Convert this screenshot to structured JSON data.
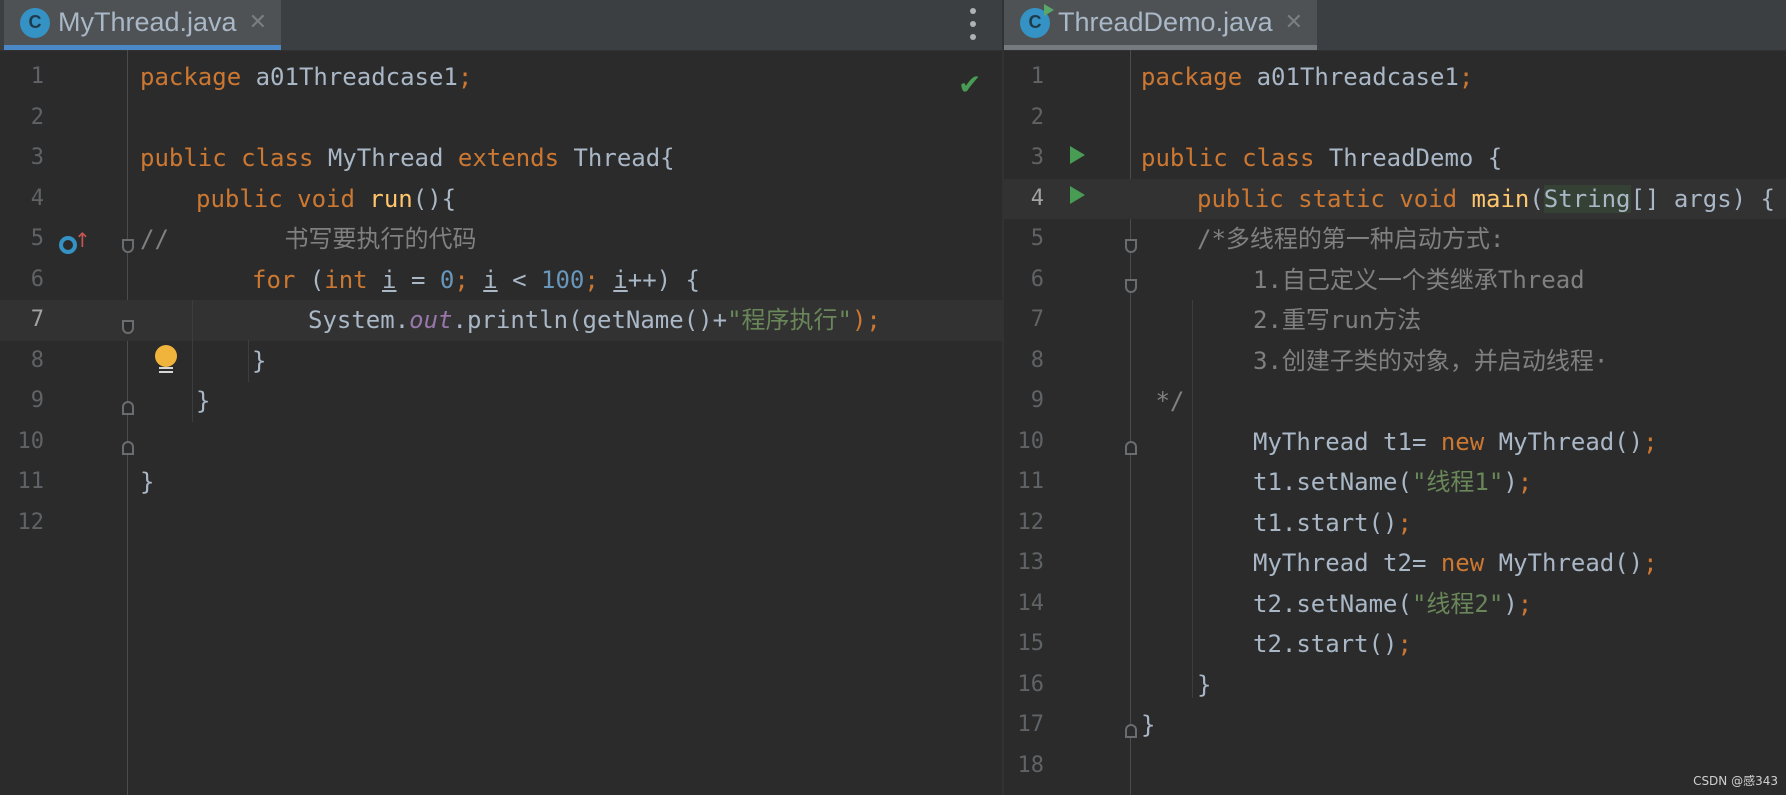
{
  "left_pane": {
    "tab": {
      "icon_letter": "C",
      "title": "MyThread.java",
      "close": "✕"
    },
    "lines": [
      {
        "n": "1",
        "indent": 0,
        "tokens": [
          {
            "t": "package ",
            "c": "kw"
          },
          {
            "t": "a01Threadcase1",
            "c": "sym"
          },
          {
            "t": ";",
            "c": "kw"
          }
        ]
      },
      {
        "n": "2",
        "indent": 0,
        "tokens": []
      },
      {
        "n": "3",
        "indent": 0,
        "tokens": [
          {
            "t": "public class ",
            "c": "kw"
          },
          {
            "t": "MyThread ",
            "c": "sym"
          },
          {
            "t": "extends ",
            "c": "kw"
          },
          {
            "t": "Thread{",
            "c": "sym"
          }
        ]
      },
      {
        "n": "4",
        "indent": 1,
        "tokens": [
          {
            "t": "public void ",
            "c": "kw"
          },
          {
            "t": "run",
            "c": "fn"
          },
          {
            "t": "(){",
            "c": "sym"
          }
        ]
      },
      {
        "n": "5",
        "indent": 0,
        "tokens": [
          {
            "t": "//        书写要执行的代码",
            "c": "cmt"
          }
        ]
      },
      {
        "n": "6",
        "indent": 2,
        "tokens": [
          {
            "t": "for ",
            "c": "kw"
          },
          {
            "t": "(",
            "c": "sym"
          },
          {
            "t": "int ",
            "c": "kw"
          },
          {
            "t": "i",
            "c": "sym und"
          },
          {
            "t": " = ",
            "c": "sym"
          },
          {
            "t": "0",
            "c": "num"
          },
          {
            "t": "; ",
            "c": "kw"
          },
          {
            "t": "i",
            "c": "sym und"
          },
          {
            "t": " < ",
            "c": "sym"
          },
          {
            "t": "100",
            "c": "num"
          },
          {
            "t": "; ",
            "c": "kw"
          },
          {
            "t": "i",
            "c": "sym und"
          },
          {
            "t": "++) {",
            "c": "sym"
          }
        ]
      },
      {
        "n": "7",
        "indent": 3,
        "tokens": [
          {
            "t": "System.",
            "c": "sym"
          },
          {
            "t": "out",
            "c": "fld"
          },
          {
            "t": ".println(getName()+",
            "c": "sym"
          },
          {
            "t": "\"程序执行\"",
            "c": "str"
          },
          {
            "t": ");",
            "c": "kw"
          }
        ]
      },
      {
        "n": "8",
        "indent": 2,
        "tokens": [
          {
            "t": "}",
            "c": "sym"
          }
        ]
      },
      {
        "n": "9",
        "indent": 1,
        "tokens": [
          {
            "t": "}",
            "c": "sym"
          }
        ]
      },
      {
        "n": "10",
        "indent": 0,
        "tokens": []
      },
      {
        "n": "11",
        "indent": 0,
        "tokens": [
          {
            "t": "}",
            "c": "sym"
          }
        ]
      },
      {
        "n": "12",
        "indent": 0,
        "tokens": []
      }
    ]
  },
  "right_pane": {
    "tab": {
      "icon_letter": "C",
      "title": "ThreadDemo.java",
      "close": "✕"
    },
    "lines": [
      {
        "n": "1",
        "indent": 0,
        "tokens": [
          {
            "t": "package ",
            "c": "kw"
          },
          {
            "t": "a01Threadcase1",
            "c": "sym"
          },
          {
            "t": ";",
            "c": "kw"
          }
        ]
      },
      {
        "n": "2",
        "indent": 0,
        "tokens": []
      },
      {
        "n": "3",
        "indent": 0,
        "tokens": [
          {
            "t": "public class ",
            "c": "kw"
          },
          {
            "t": "ThreadDemo {",
            "c": "sym"
          }
        ]
      },
      {
        "n": "4",
        "indent": 1,
        "tokens": [
          {
            "t": "public static void ",
            "c": "kw"
          },
          {
            "t": "main",
            "c": "fn"
          },
          {
            "t": "(",
            "c": "sym"
          },
          {
            "t": "String",
            "c": "sym hl"
          },
          {
            "t": "[] args) {",
            "c": "sym"
          }
        ]
      },
      {
        "n": "5",
        "indent": 1,
        "tokens": [
          {
            "t": "/*多线程的第一种启动方式:",
            "c": "cmt"
          }
        ]
      },
      {
        "n": "6",
        "indent": 2,
        "tokens": [
          {
            "t": "1.自己定义一个类继承Thread",
            "c": "cmt"
          }
        ]
      },
      {
        "n": "7",
        "indent": 2,
        "tokens": [
          {
            "t": "2.重写run方法",
            "c": "cmt"
          }
        ]
      },
      {
        "n": "8",
        "indent": 2,
        "tokens": [
          {
            "t": "3.创建子类的对象，并启动线程·",
            "c": "cmt"
          }
        ]
      },
      {
        "n": "9",
        "indent": 0,
        "tokens": [
          {
            "t": " */",
            "c": "cmt"
          }
        ]
      },
      {
        "n": "10",
        "indent": 2,
        "tokens": [
          {
            "t": "MyThread t1= ",
            "c": "sym"
          },
          {
            "t": "new ",
            "c": "kw"
          },
          {
            "t": "MyThread()",
            "c": "sym"
          },
          {
            "t": ";",
            "c": "kw"
          }
        ]
      },
      {
        "n": "11",
        "indent": 2,
        "tokens": [
          {
            "t": "t1.setName(",
            "c": "sym"
          },
          {
            "t": "\"线程1\"",
            "c": "str"
          },
          {
            "t": ")",
            "c": "sym"
          },
          {
            "t": ";",
            "c": "kw"
          }
        ]
      },
      {
        "n": "12",
        "indent": 2,
        "tokens": [
          {
            "t": "t1.start()",
            "c": "sym"
          },
          {
            "t": ";",
            "c": "kw"
          }
        ]
      },
      {
        "n": "13",
        "indent": 2,
        "tokens": [
          {
            "t": "MyThread t2= ",
            "c": "sym"
          },
          {
            "t": "new ",
            "c": "kw"
          },
          {
            "t": "MyThread()",
            "c": "sym"
          },
          {
            "t": ";",
            "c": "kw"
          }
        ]
      },
      {
        "n": "14",
        "indent": 2,
        "tokens": [
          {
            "t": "t2.setName(",
            "c": "sym"
          },
          {
            "t": "\"线程2\"",
            "c": "str"
          },
          {
            "t": ")",
            "c": "sym"
          },
          {
            "t": ";",
            "c": "kw"
          }
        ]
      },
      {
        "n": "15",
        "indent": 2,
        "tokens": [
          {
            "t": "t2.start()",
            "c": "sym"
          },
          {
            "t": ";",
            "c": "kw"
          }
        ]
      },
      {
        "n": "16",
        "indent": 1,
        "tokens": [
          {
            "t": "}",
            "c": "sym"
          }
        ]
      },
      {
        "n": "17",
        "indent": 0,
        "tokens": [
          {
            "t": "}",
            "c": "sym"
          }
        ]
      },
      {
        "n": "18",
        "indent": 0,
        "tokens": []
      }
    ]
  },
  "colors": {
    "background": "#2b2b2b",
    "keyword": "#cc7832",
    "string": "#6a8759",
    "number": "#6897bb",
    "comment": "#808080",
    "function": "#ffc66d",
    "field": "#9876aa",
    "active_tab_underline": "#4a88c7"
  },
  "icons": {
    "left_pane": [
      "class-icon",
      "close-icon",
      "more-options-icon",
      "no-problems-check-icon",
      "override-method-icon",
      "intention-bulb-icon",
      "fold-icon"
    ],
    "right_pane": [
      "runnable-class-icon",
      "close-icon",
      "run-gutter-icon",
      "fold-icon"
    ]
  },
  "watermark": "CSDN @感343"
}
